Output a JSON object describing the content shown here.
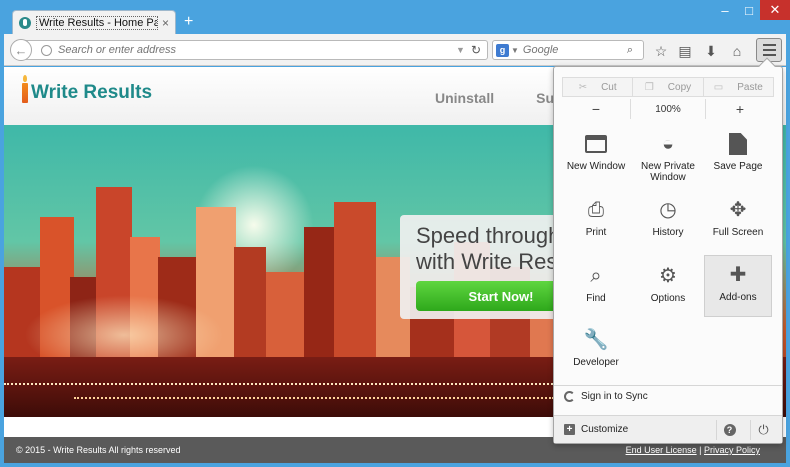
{
  "tab": {
    "title": "Write Results - Home Page",
    "close_glyph": "×"
  },
  "new_tab_glyph": "+",
  "window_controls": {
    "minimize": "–",
    "maximize": "□",
    "close": "✕"
  },
  "urlbar": {
    "placeholder": "Search or enter address"
  },
  "searchbar": {
    "placeholder": "Google",
    "engine_letter": "g"
  },
  "site": {
    "logo_text": "Write Results",
    "nav": [
      "Uninstall",
      "Supp"
    ],
    "promo_line1": "Speed through",
    "promo_line2": "with Write Res",
    "start_button": "Start Now!",
    "footer_left": "© 2015 - Write Results All rights reserved",
    "footer_links": [
      "End User License",
      "Privacy Policy"
    ],
    "footer_separator": "|"
  },
  "menu": {
    "edit": {
      "cut": "Cut",
      "copy": "Copy",
      "paste": "Paste"
    },
    "zoom": {
      "minus": "−",
      "value": "100%",
      "plus": "+"
    },
    "items": [
      {
        "label": "New Window"
      },
      {
        "label": "New Private Window"
      },
      {
        "label": "Save Page"
      },
      {
        "label": "Print"
      },
      {
        "label": "History"
      },
      {
        "label": "Full Screen"
      },
      {
        "label": "Find"
      },
      {
        "label": "Options"
      },
      {
        "label": "Add-ons"
      },
      {
        "label": "Developer"
      }
    ],
    "active_item": "Add-ons",
    "sign_in": "Sign in to Sync",
    "customize": "Customize",
    "help_glyph": "?"
  },
  "colors": {
    "titlebar": "#4aa3df",
    "brand_teal": "#1f8a8a",
    "start_green": "#2ea81b",
    "close_red": "#c7312c"
  }
}
